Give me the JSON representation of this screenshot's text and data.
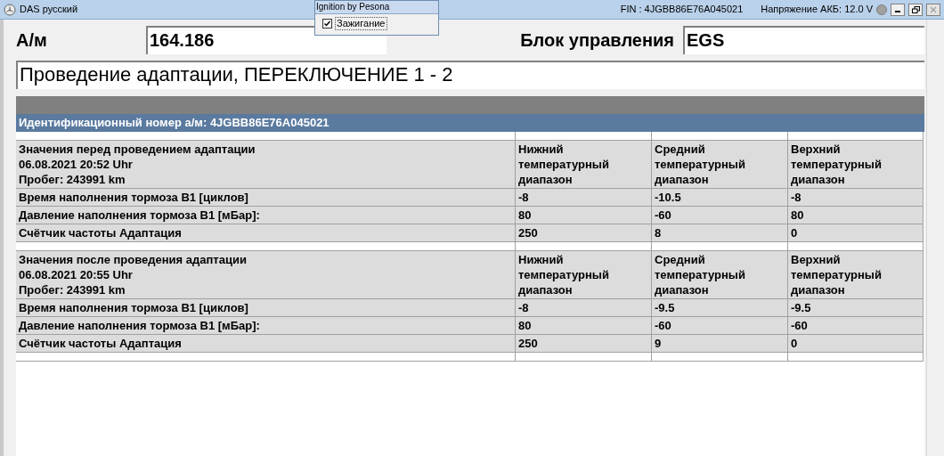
{
  "window": {
    "title": "DAS русский",
    "fin": "FIN : 4JGBB86E76A045021",
    "battery": "Напряжение АКБ: 12.0 V",
    "close_disabled": true
  },
  "popup": {
    "title": "Ignition by Pesona",
    "checkbox": {
      "label": "Зажигание",
      "checked": true
    }
  },
  "fields": [
    {
      "label": "А/м",
      "value": "164.186"
    },
    {
      "label": "Блок управления",
      "value": "EGS"
    }
  ],
  "procedure": "Проведение адаптации, ПЕРЕКЛЮЧЕНИЕ 1 - 2",
  "vin_band": "Идентификационный номер а/м:  4JGBB86E76A045021",
  "sections": [
    {
      "header": "Значения перед проведением адаптации\n06.08.2021  20:52 Uhr\nПробег: 243991 km",
      "columns": [
        "Нижний\nтемпературный\nдиапазон",
        "Средний\nтемпературный\nдиапазон",
        "Верхний\nтемпературный\nдиапазон"
      ],
      "rows": [
        {
          "label": "Время наполнения тормоза B1 [циклов]",
          "values": [
            "-8",
            "-10.5",
            "-8"
          ]
        },
        {
          "label": "Давление наполнения тормоза B1 [мБар]:",
          "values": [
            "80",
            "-60",
            "80"
          ]
        },
        {
          "label": "Счётчик частоты Адаптация",
          "values": [
            "250",
            "8",
            "0"
          ]
        }
      ]
    },
    {
      "header": "Значения после проведения адаптации\n06.08.2021  20:55 Uhr\nПробег: 243991 km",
      "columns": [
        "Нижний\nтемпературный\nдиапазон",
        "Средний\nтемпературный\nдиапазон",
        "Верхний\nтемпературный\nдиапазон"
      ],
      "rows": [
        {
          "label": "Время наполнения тормоза B1 [циклов]",
          "values": [
            "-8",
            "-9.5",
            "-9.5"
          ]
        },
        {
          "label": "Давление наполнения тормоза B1 [мБар]:",
          "values": [
            "80",
            "-60",
            "-60"
          ]
        },
        {
          "label": "Счётчик частоты Адаптация",
          "values": [
            "250",
            "9",
            "0"
          ]
        }
      ]
    }
  ]
}
